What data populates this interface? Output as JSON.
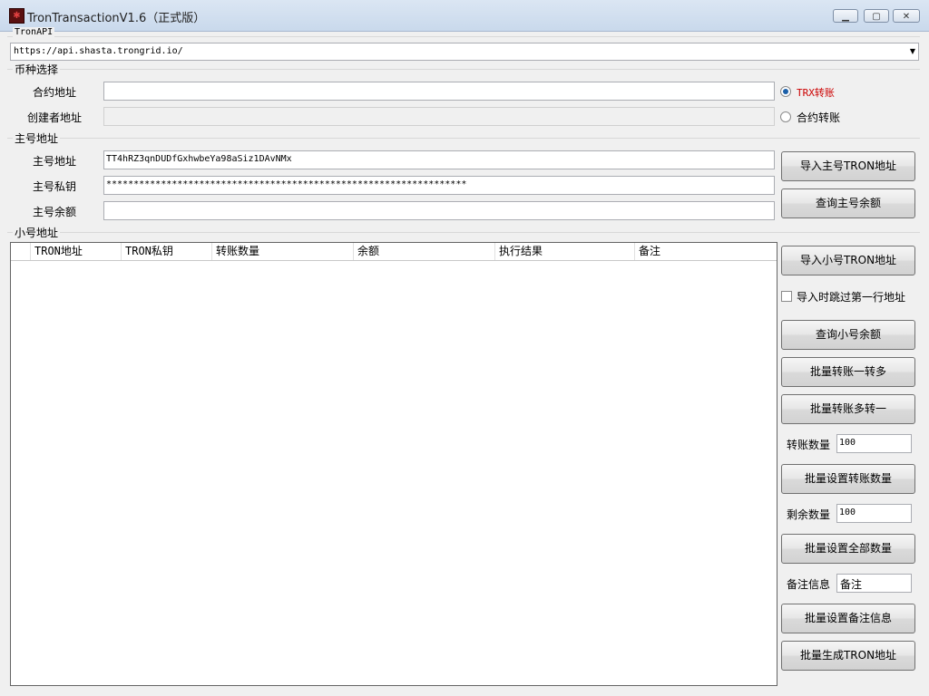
{
  "window": {
    "title": "TronTransactionV1.6（正式版）",
    "app_icon_glyph": "✱",
    "minimize_glyph": "▁",
    "maximize_glyph": "▢",
    "close_glyph": "✕"
  },
  "tronapi": {
    "group_label": "TronAPI",
    "url": "https://api.shasta.trongrid.io/",
    "dropdown_glyph": "▼"
  },
  "coin": {
    "group_label": "币种选择",
    "contract_label": "合约地址",
    "contract_value": "",
    "creator_label": "创建者地址",
    "creator_value": "",
    "radio_trx": "TRX转账",
    "radio_contract": "合约转账",
    "selected": "TRX转账",
    "accent_color": "#cc0000"
  },
  "main_account": {
    "group_label": "主号地址",
    "address_label": "主号地址",
    "address_value": "TT4hRZ3qnDUDfGxhwbeYa98aSiz1DAvNMx",
    "key_label": "主号私钥",
    "key_value": "******************************************************************",
    "balance_label": "主号余额",
    "balance_value": "",
    "import_button": "导入主号TRON地址",
    "query_button": "查询主号余额"
  },
  "sub_accounts": {
    "group_label": "小号地址",
    "columns": [
      "TRON地址",
      "TRON私钥",
      "转账数量",
      "余额",
      "执行结果",
      "备注"
    ],
    "rows": []
  },
  "side_panel": {
    "import_sub_button": "导入小号TRON地址",
    "skip_first_row_label": "导入时跳过第一行地址",
    "skip_first_row_checked": false,
    "query_sub_button": "查询小号余额",
    "batch_one_to_many_button": "批量转账一转多",
    "batch_many_to_one_button": "批量转账多转一",
    "amount_label": "转账数量",
    "amount_value": "100",
    "set_amount_button": "批量设置转账数量",
    "remain_label": "剩余数量",
    "remain_value": "100",
    "set_all_button": "批量设置全部数量",
    "note_label": "备注信息",
    "note_value": "备注",
    "set_note_button": "批量设置备注信息",
    "generate_button": "批量生成TRON地址"
  }
}
